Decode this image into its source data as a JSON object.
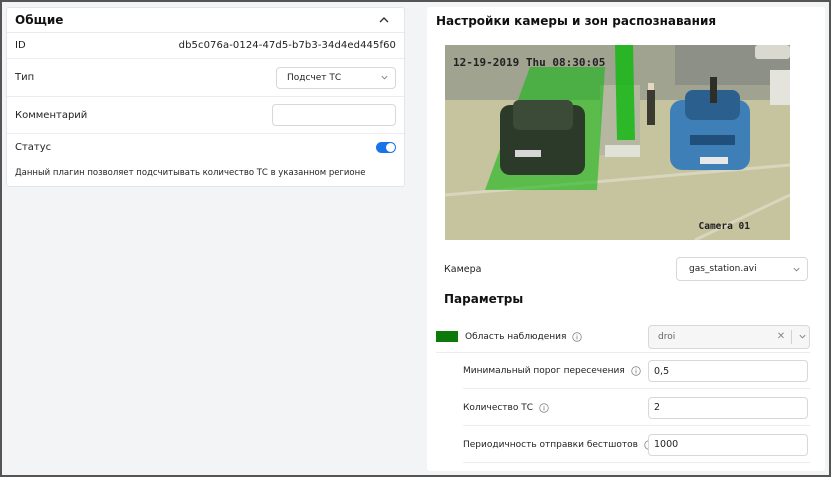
{
  "general": {
    "title": "Общие",
    "id_label": "ID",
    "id_value": "db5c076a-0124-47d5-b7b3-34d4ed445f60",
    "type_label": "Тип",
    "type_value": "Подсчет ТС",
    "comment_label": "Комментарий",
    "comment_value": "",
    "status_label": "Статус",
    "status_on": true,
    "description": "Данный плагин позволяет подсчитывать количество ТС в указанном регионе"
  },
  "camera_settings": {
    "title": "Настройки камеры и зон распознавания",
    "timestamp": "12-19-2019 Thu 08:30:05",
    "camera_overlay_name": "Camera 01",
    "camera_label": "Камера",
    "camera_value": "gas_station.avi"
  },
  "params": {
    "title": "Параметры",
    "zone_color": "#0b7a0b",
    "observation_area_label": "Область наблюдения",
    "observation_area_value": "droi",
    "min_threshold_label": "Минимальный порог пересечения",
    "min_threshold_value": "0,5",
    "vehicle_count_label": "Количество ТС",
    "vehicle_count_value": "2",
    "snapshot_period_label": "Периодичность отправки бестшотов",
    "snapshot_period_value": "1000"
  },
  "colors": {
    "toggle_on": "#1a73e8",
    "zone_overlay": "#14b814"
  }
}
